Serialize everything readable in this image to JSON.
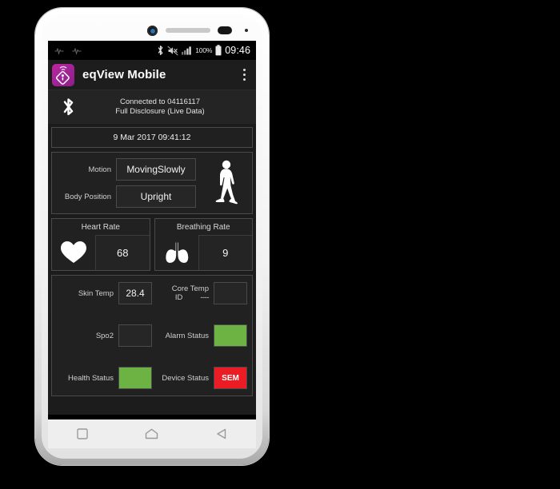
{
  "status_bar": {
    "left_icons": [
      "pulse-icon",
      "pulse-icon"
    ],
    "bluetooth_icon": "bluetooth-icon",
    "mute_icon": "volume-mute-icon",
    "signal_icon": "cellular-signal-icon",
    "battery_percent": "100%",
    "battery_icon": "battery-full-icon",
    "clock": "09:46"
  },
  "app_bar": {
    "icon_name": "eqview-app-icon",
    "title": "eqView Mobile",
    "overflow_label": "more-options"
  },
  "connection": {
    "icon_name": "bluetooth-icon",
    "line1": "Connected to 04116117",
    "line2": "Full Disclosure (Live Data)"
  },
  "timestamp": {
    "value": "9 Mar 2017 09:41:12"
  },
  "motion_panel": {
    "motion_label": "Motion",
    "motion_value": "MovingSlowly",
    "body_position_label": "Body Position",
    "body_position_value": "Upright",
    "figure_icon": "walking-person-icon"
  },
  "vitals": [
    {
      "title": "Heart Rate",
      "icon": "heart-icon",
      "value": "68"
    },
    {
      "title": "Breathing Rate",
      "icon": "lungs-icon",
      "value": "9"
    }
  ],
  "metrics": {
    "skin_temp_label": "Skin Temp",
    "skin_temp_value": "28.4",
    "core_temp_label": "Core Temp",
    "core_temp_value": "",
    "id_label": "ID",
    "id_value": "----",
    "spo2_label": "Spo2",
    "spo2_value": "",
    "alarm_status_label": "Alarm Status",
    "alarm_status_value": "",
    "health_status_label": "Health Status",
    "health_status_value": "",
    "device_status_label": "Device Status",
    "device_status_value": "SEM"
  },
  "colors": {
    "status_green": "#6CB344",
    "status_red": "#EC1C24",
    "accent_magenta": "#B0229C",
    "screen_bg": "#1c1c1c"
  },
  "nav_bar": {
    "recents_label": "recents-button",
    "home_label": "home-button",
    "back_label": "back-button"
  }
}
